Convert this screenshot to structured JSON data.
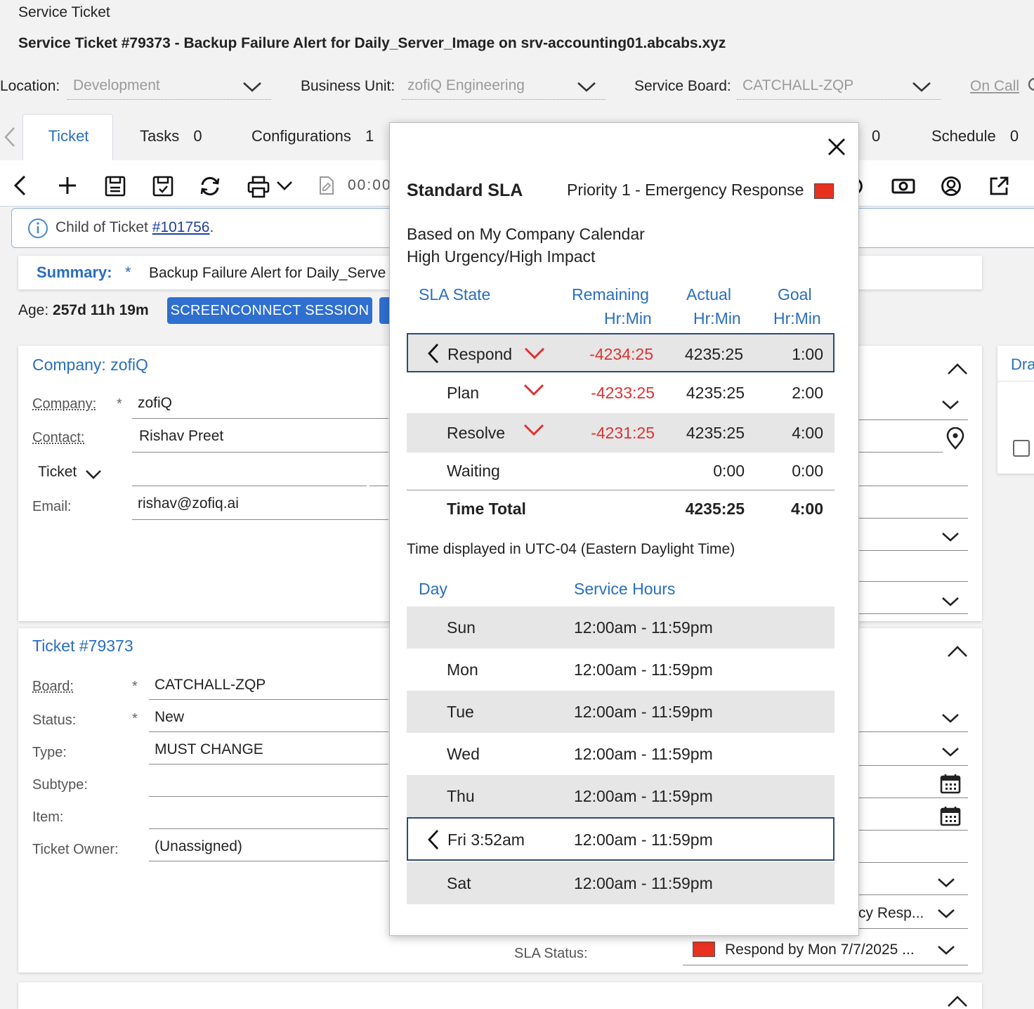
{
  "window": {
    "breadcrumb": "Service Ticket",
    "title": "Service Ticket #79373 - Backup Failure Alert for Daily_Server_Image on srv-accounting01.abcabs.xyz"
  },
  "filters": {
    "location_label": "Location:",
    "location_value": "Development",
    "business_unit_label": "Business Unit:",
    "business_unit_value": "zofiQ Engineering",
    "service_board_label": "Service Board:",
    "service_board_value": "CATCHALL-ZQP",
    "on_call_link": "On Call"
  },
  "tabs": {
    "ticket": "Ticket",
    "tasks": "Tasks",
    "tasks_count": "0",
    "configurations": "Configurations",
    "configurations_count": "1",
    "hidden_count": "0",
    "schedule": "Schedule",
    "schedule_count": "0"
  },
  "toolbar": {
    "timer": "00:00"
  },
  "notice": {
    "prefix": "Child of Ticket ",
    "link": "#101756",
    "suffix": "."
  },
  "summary": {
    "label": "Summary:",
    "required": "*",
    "value": "Backup Failure Alert for Daily_Serve"
  },
  "age": {
    "label": "Age:",
    "value": "257d 11h 19m",
    "screenconnect_button": "SCREENCONNECT SESSION"
  },
  "company_panel": {
    "header": "Company: zofiQ",
    "company_label": "Company:",
    "required": "*",
    "company_value": "zofiQ",
    "contact_label": "Contact:",
    "contact_value": "Rishav Preet",
    "ticket_dropdown": "Ticket",
    "email_label": "Email:",
    "email_value": "rishav@zofiq.ai"
  },
  "right_stub": {
    "label": "Dra"
  },
  "ticket_panel": {
    "header": "Ticket #79373",
    "board_label": "Board:",
    "board_value": "CATCHALL-ZQP",
    "status_label": "Status:",
    "status_value": "New",
    "required": "*",
    "type_label": "Type:",
    "type_value": "MUST CHANGE",
    "subtype_label": "Subtype:",
    "item_label": "Item:",
    "owner_label": "Ticket Owner:",
    "owner_value": "(Unassigned)",
    "priority_truncated": "cy Resp...",
    "sla_status_label": "SLA Status:",
    "sla_status_value": "Respond by Mon 7/7/2025 ..."
  },
  "sla_popup": {
    "title": "Standard SLA",
    "priority": "Priority 1 - Emergency Response",
    "priority_color": "#e8321f",
    "calendar_line": "Based on My Company Calendar",
    "urgency_line": "High Urgency/High Impact",
    "columns": {
      "state": "SLA State",
      "remaining": "Remaining",
      "actual": "Actual",
      "goal": "Goal",
      "unit": "Hr:Min"
    },
    "rows": [
      {
        "state": "Respond",
        "remaining": "-4234:25",
        "actual": "4235:25",
        "goal": "1:00"
      },
      {
        "state": "Plan",
        "remaining": "-4233:25",
        "actual": "4235:25",
        "goal": "2:00"
      },
      {
        "state": "Resolve",
        "remaining": "-4231:25",
        "actual": "4235:25",
        "goal": "4:00"
      },
      {
        "state": "Waiting",
        "remaining": "",
        "actual": "0:00",
        "goal": "0:00"
      }
    ],
    "total": {
      "label": "Time Total",
      "actual": "4235:25",
      "goal": "4:00"
    },
    "timezone_note": "Time displayed in UTC-04 (Eastern Daylight Time)",
    "hours_columns": {
      "day": "Day",
      "hours": "Service Hours"
    },
    "hours": [
      {
        "day": "Sun",
        "hours": "12:00am - 11:59pm"
      },
      {
        "day": "Mon",
        "hours": "12:00am - 11:59pm"
      },
      {
        "day": "Tue",
        "hours": "12:00am - 11:59pm"
      },
      {
        "day": "Wed",
        "hours": "12:00am - 11:59pm"
      },
      {
        "day": "Thu",
        "hours": "12:00am - 11:59pm"
      },
      {
        "day": "Fri 3:52am",
        "hours": "12:00am - 11:59pm"
      },
      {
        "day": "Sat",
        "hours": "12:00am - 11:59pm"
      }
    ],
    "accent_red": "#d33",
    "accent_blue": "#2a6ebf"
  }
}
